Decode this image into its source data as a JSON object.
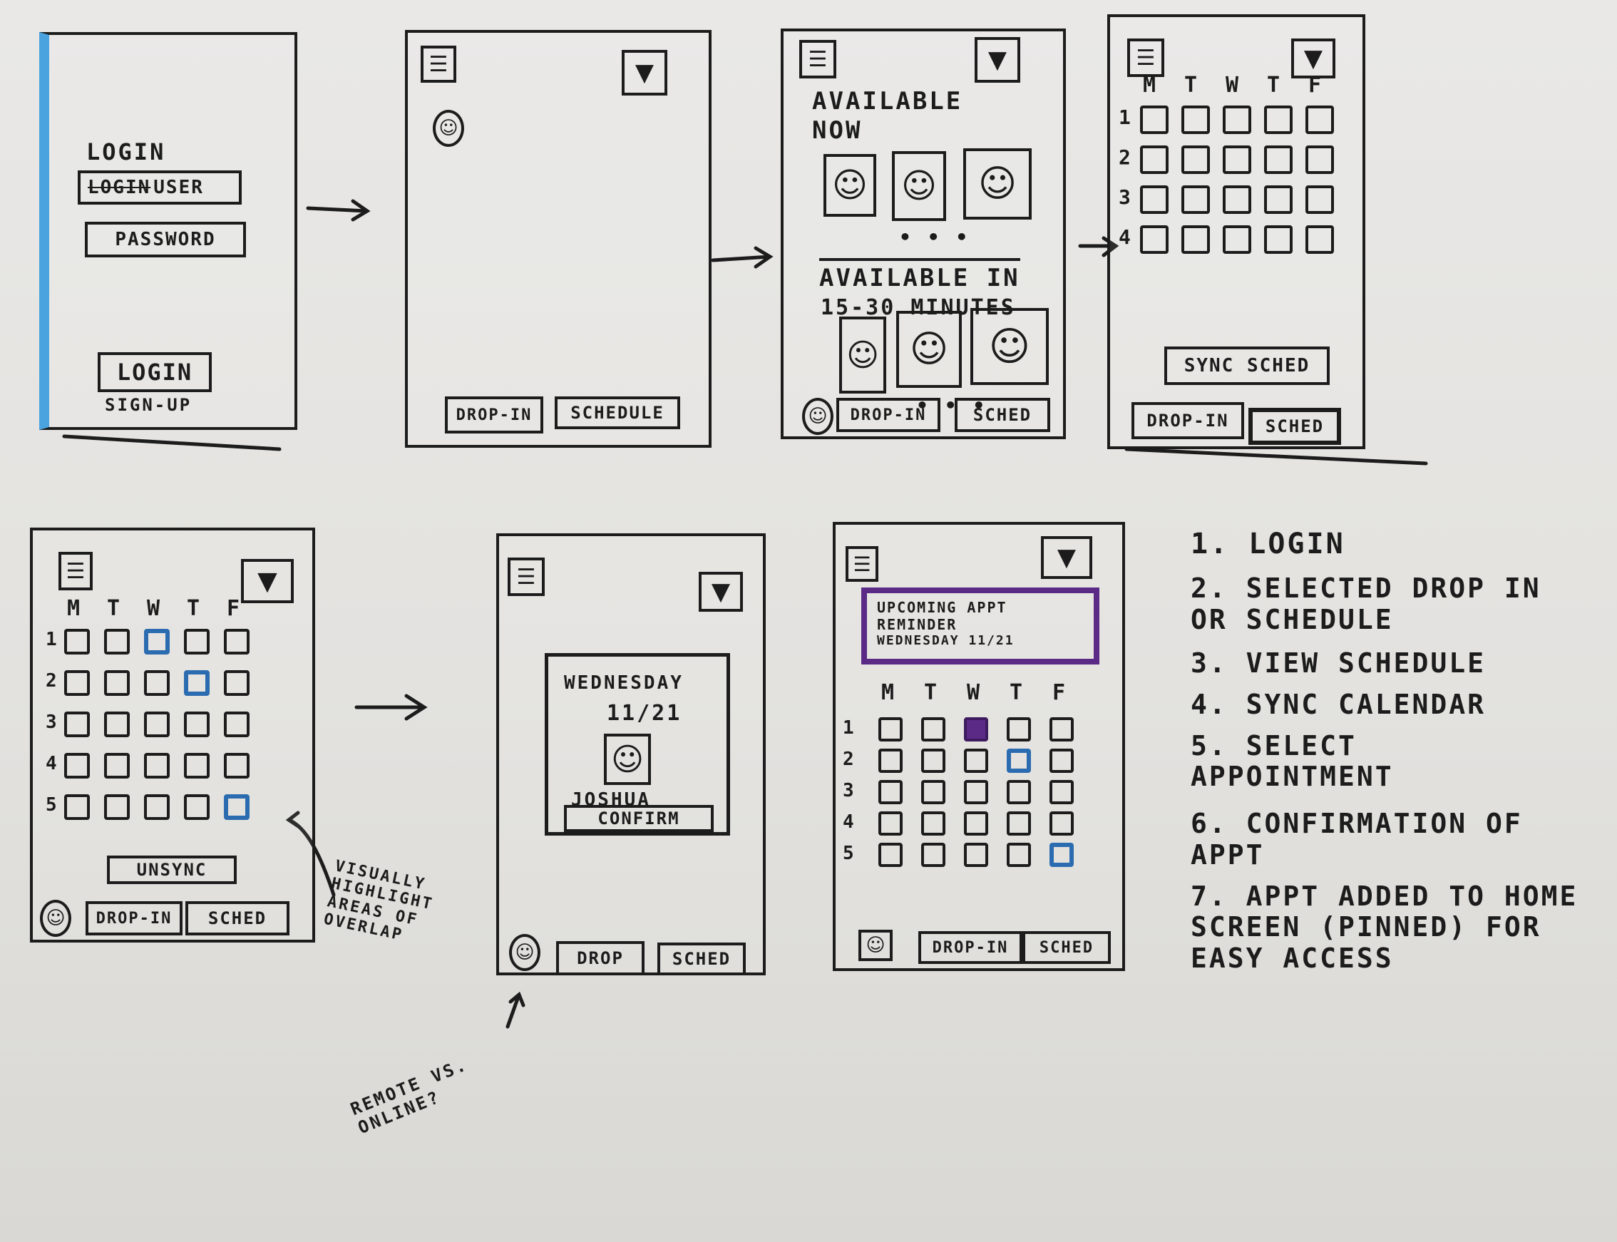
{
  "screen1": {
    "title": "Login",
    "user_field": "User",
    "user_field_struck": "Login",
    "password_field": "Password",
    "login_button": "Login",
    "signup_link": "Sign-up"
  },
  "screen2": {
    "drop_in_tab": "Drop-In",
    "schedule_tab": "Schedule"
  },
  "screen3": {
    "available_now": "Available Now",
    "available_in": "Available In",
    "available_in_time": "15-30 minutes",
    "drop_in_tab": "Drop-In",
    "sched_tab": "Sched"
  },
  "screen4": {
    "days": [
      "M",
      "T",
      "W",
      "T",
      "F"
    ],
    "rows": [
      "1",
      "2",
      "3",
      "4"
    ],
    "sync_button": "Sync Sched",
    "drop_in_tab": "Drop-In",
    "sched_tab": "Sched"
  },
  "screen5": {
    "days": [
      "M",
      "T",
      "W",
      "T",
      "F"
    ],
    "rows": [
      "1",
      "2",
      "3",
      "4",
      "5"
    ],
    "unsync_button": "Unsync",
    "drop_in_tab": "Drop-In",
    "sched_tab": "Sched",
    "annotation": "Visually highlight areas of overlap"
  },
  "screen6": {
    "day": "Wednesday",
    "date": "11/21",
    "person": "Joshua",
    "confirm_button": "Confirm",
    "drop_tab": "Drop",
    "sched_tab": "Sched",
    "annotation": "Remote vs. online?"
  },
  "screen7": {
    "reminder_line1": "Upcoming Appt",
    "reminder_line2": "Reminder",
    "reminder_line3": "Wednesday 11/21",
    "days": [
      "M",
      "T",
      "W",
      "T",
      "F"
    ],
    "rows": [
      "1",
      "2",
      "3",
      "4",
      "5"
    ],
    "drop_in_tab": "Drop-In",
    "sched_tab": "Sched"
  },
  "steps": [
    "1. Login",
    "2. Selected drop in or schedule",
    "3. View schedule",
    "4. Sync calendar",
    "5. Select appointment",
    "6. Confirmation of appt",
    "7. Appt added to home screen (pinned) for easy access"
  ],
  "colors": {
    "ink": "#1c1c1c",
    "highlight_blue": "#2b6cb0",
    "reminder_purple": "#5b2a86",
    "marker_blue": "#4aa3df"
  }
}
